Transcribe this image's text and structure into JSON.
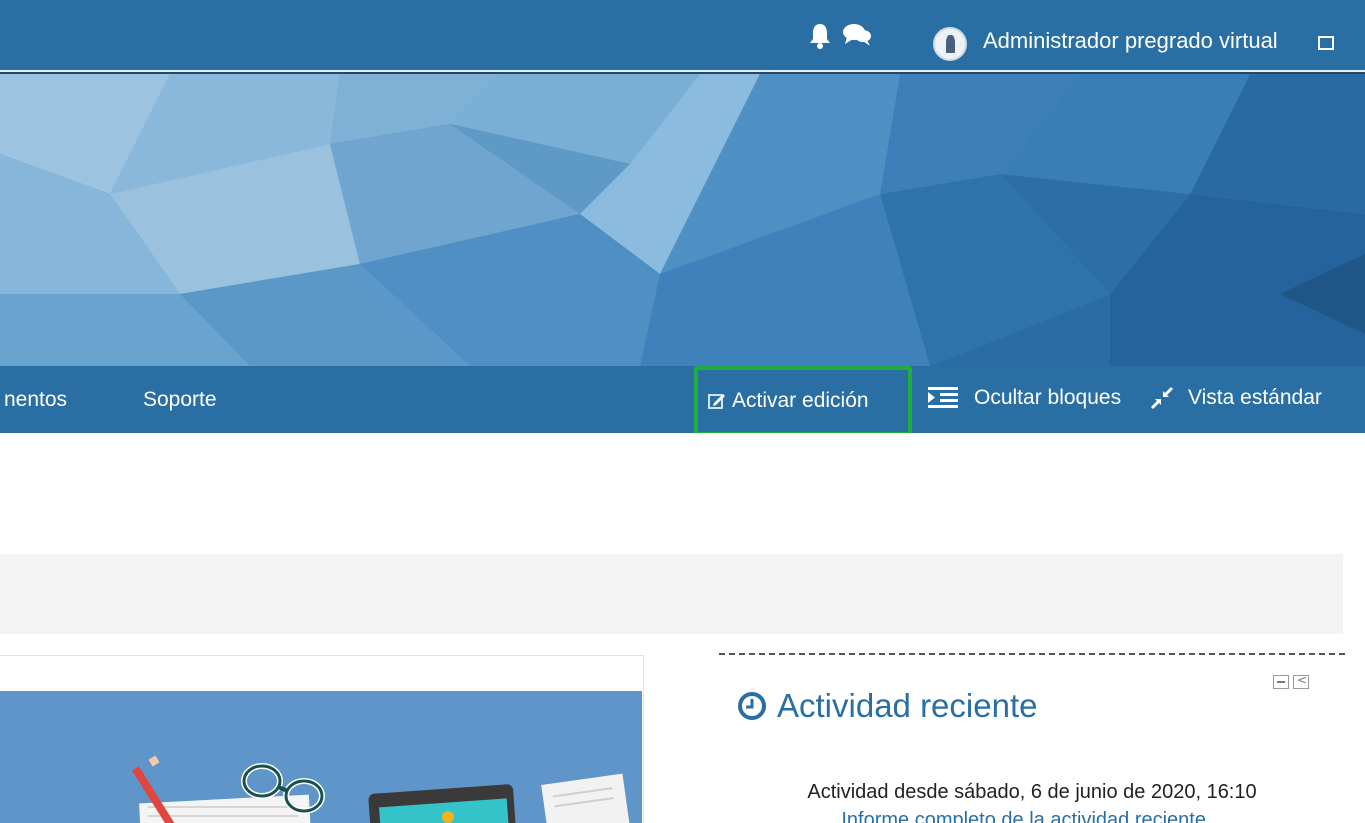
{
  "topbar": {
    "user_name": "Administrador pregrado virtual",
    "icons": [
      "bell-icon",
      "chat-icon",
      "avatar",
      "menu-toggle-icon"
    ]
  },
  "navbar": {
    "items": [
      {
        "label": "nentos"
      },
      {
        "label": "Soporte"
      }
    ],
    "edit_button": {
      "label": "Activar edición",
      "icon": "edit-icon",
      "highlight_color": "#1fae3e"
    },
    "hide_blocks": {
      "label": "Ocultar bloques",
      "icon": "indent-icon"
    },
    "standard_view": {
      "label": "Vista estándar",
      "icon": "compress-icon"
    }
  },
  "activity": {
    "title": "Actividad reciente",
    "icon": "clock-icon",
    "since": "Actividad desde sábado, 6 de junio de 2020, 16:10",
    "report_link": "Informe completo de la actividad reciente..."
  },
  "colors": {
    "primary": "#2a6fa3",
    "outer": "#1c4a6e",
    "highlight": "#1fae3e"
  }
}
